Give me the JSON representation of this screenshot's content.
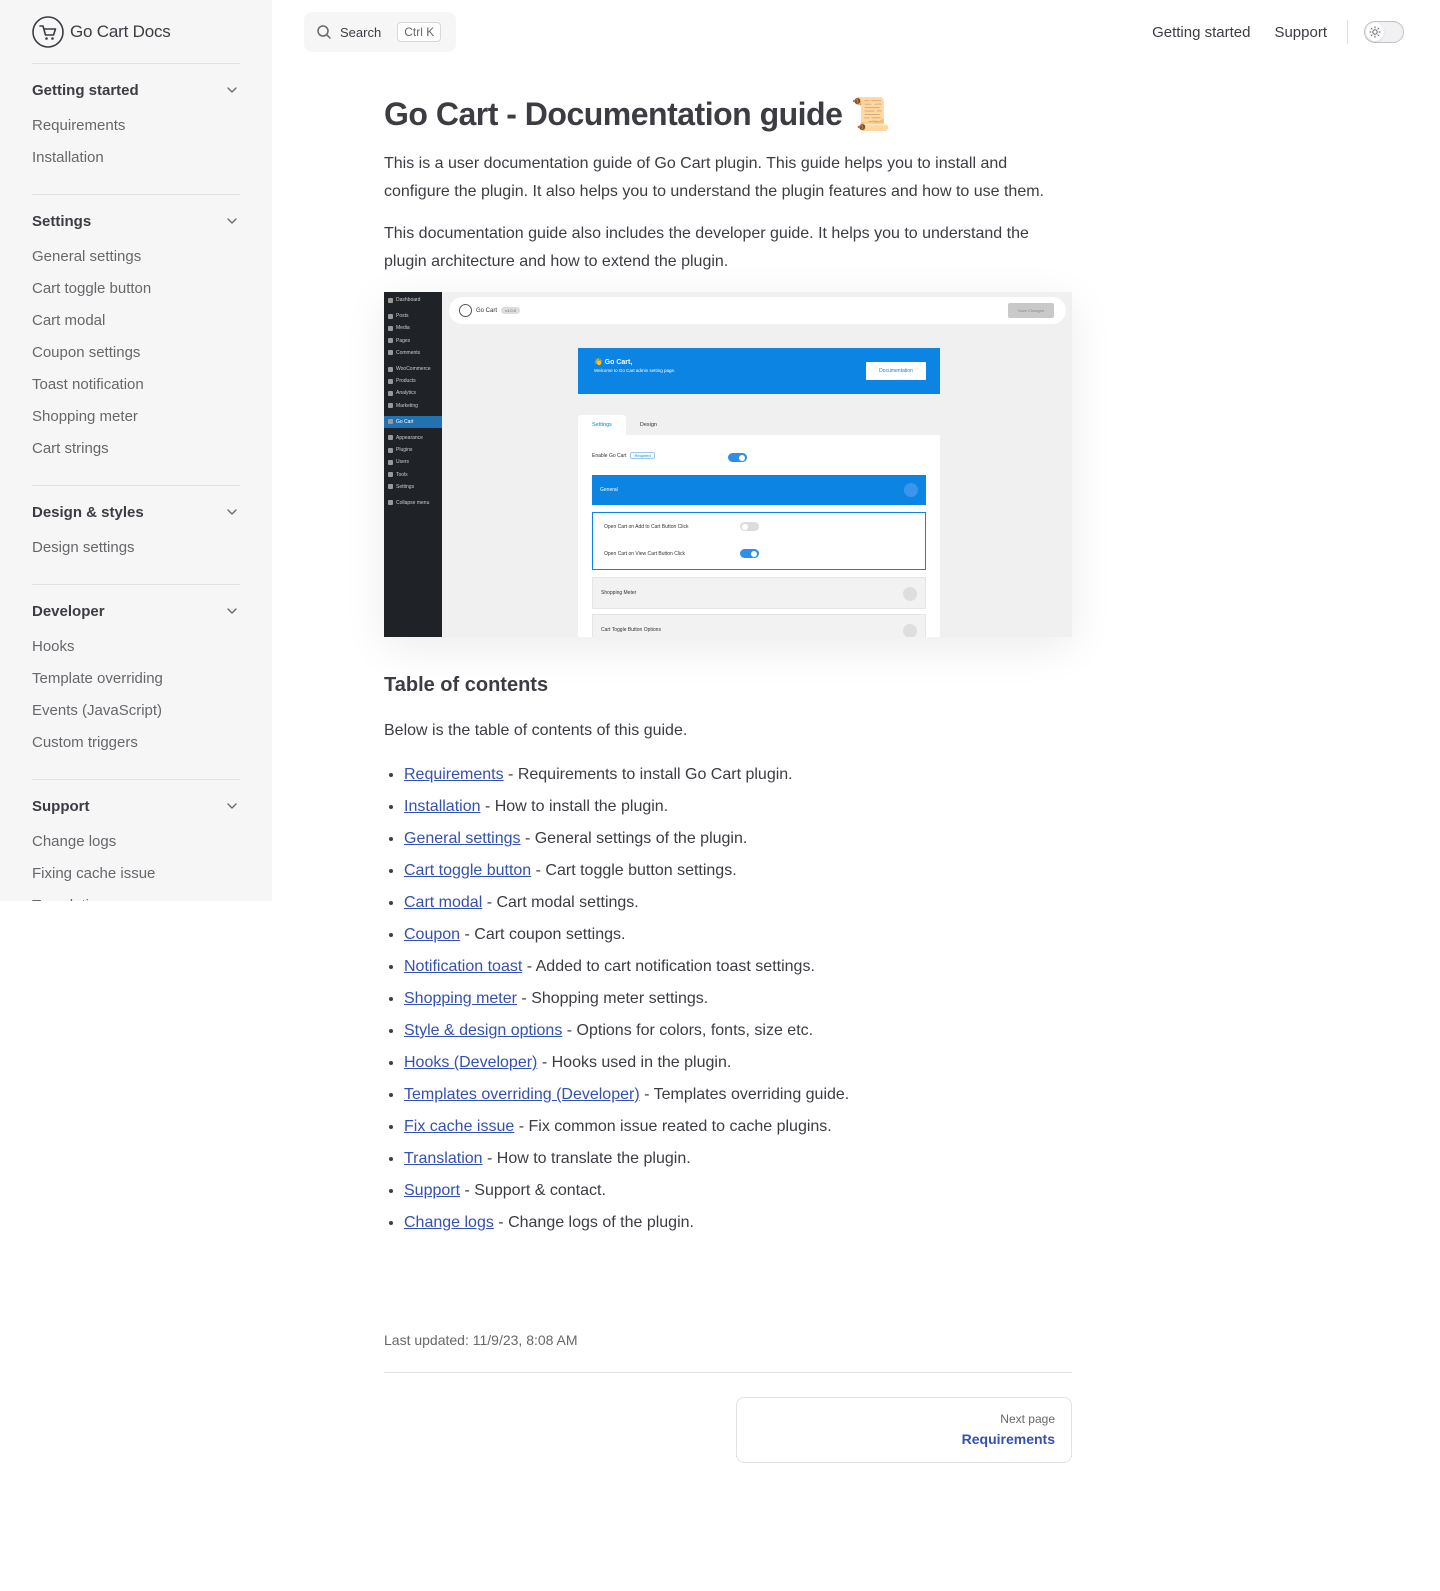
{
  "brand": {
    "name": "Go Cart Docs"
  },
  "search": {
    "label": "Search",
    "shortcut": "Ctrl K"
  },
  "topnav": {
    "items": [
      "Getting started",
      "Support"
    ]
  },
  "sidebar": {
    "groups": [
      {
        "title": "Getting started",
        "items": [
          "Requirements",
          "Installation"
        ]
      },
      {
        "title": "Settings",
        "items": [
          "General settings",
          "Cart toggle button",
          "Cart modal",
          "Coupon settings",
          "Toast notification",
          "Shopping meter",
          "Cart strings"
        ]
      },
      {
        "title": "Design & styles",
        "items": [
          "Design settings"
        ]
      },
      {
        "title": "Developer",
        "items": [
          "Hooks",
          "Template overriding",
          "Events (JavaScript)",
          "Custom triggers"
        ]
      },
      {
        "title": "Support",
        "items": [
          "Change logs",
          "Fixing cache issue",
          "Translation"
        ]
      }
    ]
  },
  "page": {
    "title": "Go Cart - Documentation guide 📜",
    "intro": "This is a user documentation guide of Go Cart plugin. This guide helps you to install and configure the plugin. It also helps you to understand the plugin features and how to use them.",
    "intro2": "This documentation guide also includes the developer guide. It helps you to understand the plugin architecture and how to extend the plugin.",
    "toc_heading": "Table of contents",
    "toc_intro": "Below is the table of contents of this guide.",
    "toc": [
      {
        "link": "Requirements",
        "desc": " - Requirements to install Go Cart plugin."
      },
      {
        "link": "Installation",
        "desc": " - How to install the plugin."
      },
      {
        "link": "General settings",
        "desc": " - General settings of the plugin."
      },
      {
        "link": "Cart toggle button",
        "desc": " - Cart toggle button settings."
      },
      {
        "link": "Cart modal",
        "desc": " - Cart modal settings."
      },
      {
        "link": "Coupon",
        "desc": " - Cart coupon settings."
      },
      {
        "link": "Notification toast",
        "desc": " - Added to cart notification toast settings."
      },
      {
        "link": "Shopping meter",
        "desc": " - Shopping meter settings."
      },
      {
        "link": "Style & design options",
        "desc": " - Options for colors, fonts, size etc."
      },
      {
        "link": "Hooks (Developer)",
        "desc": " - Hooks used in the plugin."
      },
      {
        "link": "Templates overriding (Developer)",
        "desc": " - Templates overriding guide."
      },
      {
        "link": "Fix cache issue",
        "desc": " - Fix common issue reated to cache plugins."
      },
      {
        "link": "Translation",
        "desc": " - How to translate the plugin."
      },
      {
        "link": "Support",
        "desc": " - Support & contact."
      },
      {
        "link": "Change logs",
        "desc": " - Change logs of the plugin."
      }
    ],
    "last_updated": "Last updated: 11/9/23, 8:08 AM",
    "next": {
      "label": "Next page",
      "title": "Requirements"
    }
  },
  "hero": {
    "wp_menu": [
      "Dashboard",
      "Posts",
      "Media",
      "Pages",
      "Comments",
      "WooCommerce",
      "Products",
      "Analytics",
      "Marketing",
      "Go Cart",
      "Appearance",
      "Plugins",
      "Users",
      "Tools",
      "Settings",
      "Collapse menu"
    ],
    "top_name": "Go Cart",
    "top_version": "v1.0.0",
    "top_button": "Save Changes",
    "banner_title": "👋 Go Cart,",
    "banner_sub": "Welcome to Go Cart admin setting page.",
    "banner_button": "Documentation",
    "tabs": [
      "Settings",
      "Design"
    ],
    "enable_label": "Enable Go Cart",
    "enable_badge": "Required",
    "general": "General",
    "opt1": "Open Cart on Add to Cart Button Click",
    "opt2": "Open Cart on View Cart Button Click",
    "shopping_meter": "Shopping Meter",
    "toggle_options": "Cart Toggle Button Options"
  },
  "colors": {
    "accent": "#3451b2",
    "sidebar_bg": "#f6f6f7",
    "text": "#3c3c43",
    "wp_blue": "#0b84e3"
  }
}
